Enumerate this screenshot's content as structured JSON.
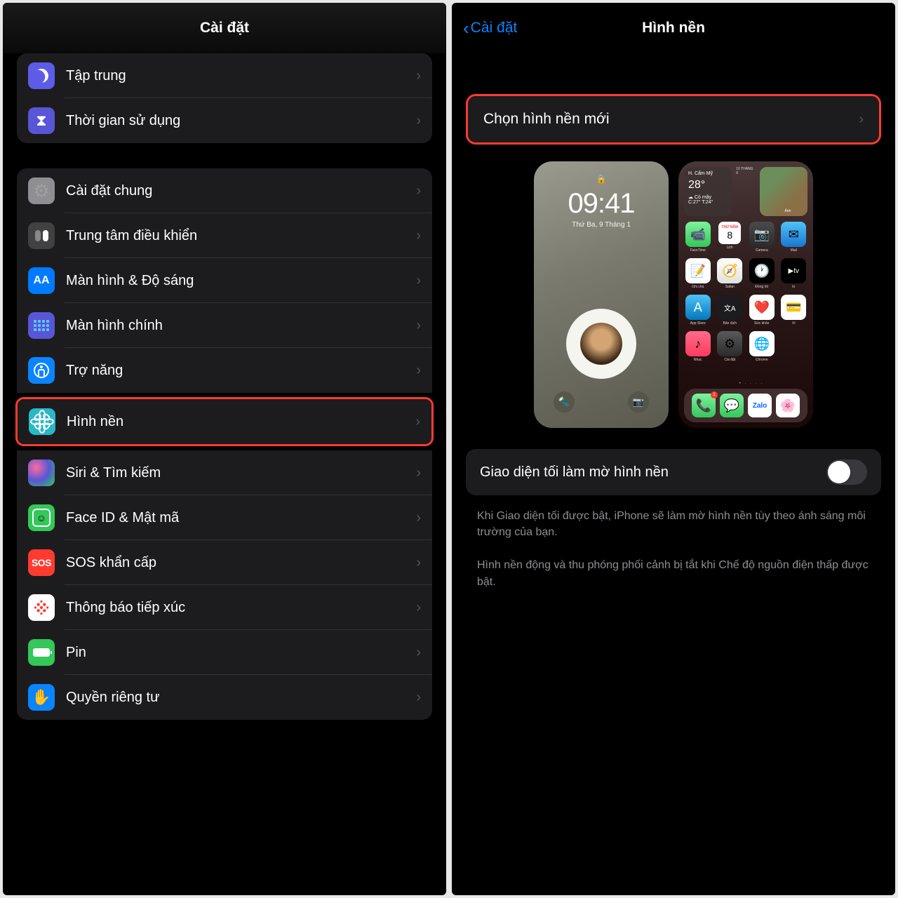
{
  "left": {
    "title": "Cài đặt",
    "group1": [
      {
        "label": "Tập trung",
        "icon": "moon",
        "bg": "ic-purple"
      },
      {
        "label": "Thời gian sử dụng",
        "icon": "hourglass",
        "bg": "ic-indigo"
      }
    ],
    "group2a": [
      {
        "label": "Cài đặt chung",
        "icon": "gear",
        "bg": "ic-gray"
      },
      {
        "label": "Trung tâm điều khiển",
        "icon": "cc",
        "bg": "ic-darkgray"
      },
      {
        "label": "Màn hình & Độ sáng",
        "icon": "aa",
        "bg": "ic-blue"
      },
      {
        "label": "Màn hình chính",
        "icon": "dots",
        "bg": "ic-indigo"
      },
      {
        "label": "Trợ năng",
        "icon": "access",
        "bg": "ic-blue2"
      }
    ],
    "wallpaper": {
      "label": "Hình nền",
      "icon": "flower",
      "bg": "ic-teal"
    },
    "group2b": [
      {
        "label": "Siri & Tìm kiếm",
        "icon": "siri",
        "bg": "ic-siri"
      },
      {
        "label": "Face ID & Mật mã",
        "icon": "face",
        "bg": "ic-green"
      },
      {
        "label": "SOS khẩn cấp",
        "icon": "sos",
        "bg": "ic-red"
      },
      {
        "label": "Thông báo tiếp xúc",
        "icon": "exposure",
        "bg": "ic-red2"
      },
      {
        "label": "Pin",
        "icon": "battery",
        "bg": "ic-greenpin"
      },
      {
        "label": "Quyền riêng tư",
        "icon": "hand",
        "bg": "ic-blue2"
      }
    ]
  },
  "right": {
    "back": "Cài đặt",
    "title": "Hình nền",
    "choose": "Chọn hình nền mới",
    "lock": {
      "time": "09:41",
      "date": "Thứ Ba, 9 Tháng 1"
    },
    "home_widgets": {
      "weather_loc": "H. Cẩm Mỹ",
      "weather_temp": "C:27° T:24°",
      "cal_day": "THỨ NĂM",
      "cal_num": "8",
      "photo_label": "Ảnh",
      "photo_date": "10 THÁNG 6"
    },
    "apps": {
      "facetime": "FaceTime",
      "lich": "Lịch",
      "camera": "Camera",
      "mail": "Mail",
      "ghichu": "Ghi chú",
      "safari": "Safari",
      "dongho": "Đồng hồ",
      "tv": "tv",
      "appstore": "App Store",
      "bandich": "Bản dịch",
      "suckhoe": "Sức khỏe",
      "vi": "Ví",
      "music": "Nhạc",
      "caidat": "Cài đặt",
      "chrome": "Chrome"
    },
    "toggle_label": "Giao diện tối làm mờ hình nền",
    "footer1": "Khi Giao diện tối được bật, iPhone sẽ làm mờ hình nền tùy theo ánh sáng môi trường của bạn.",
    "footer2": "Hình nền động và thu phóng phối cảnh bị tắt khi Chế độ nguồn điện thấp được bật."
  }
}
